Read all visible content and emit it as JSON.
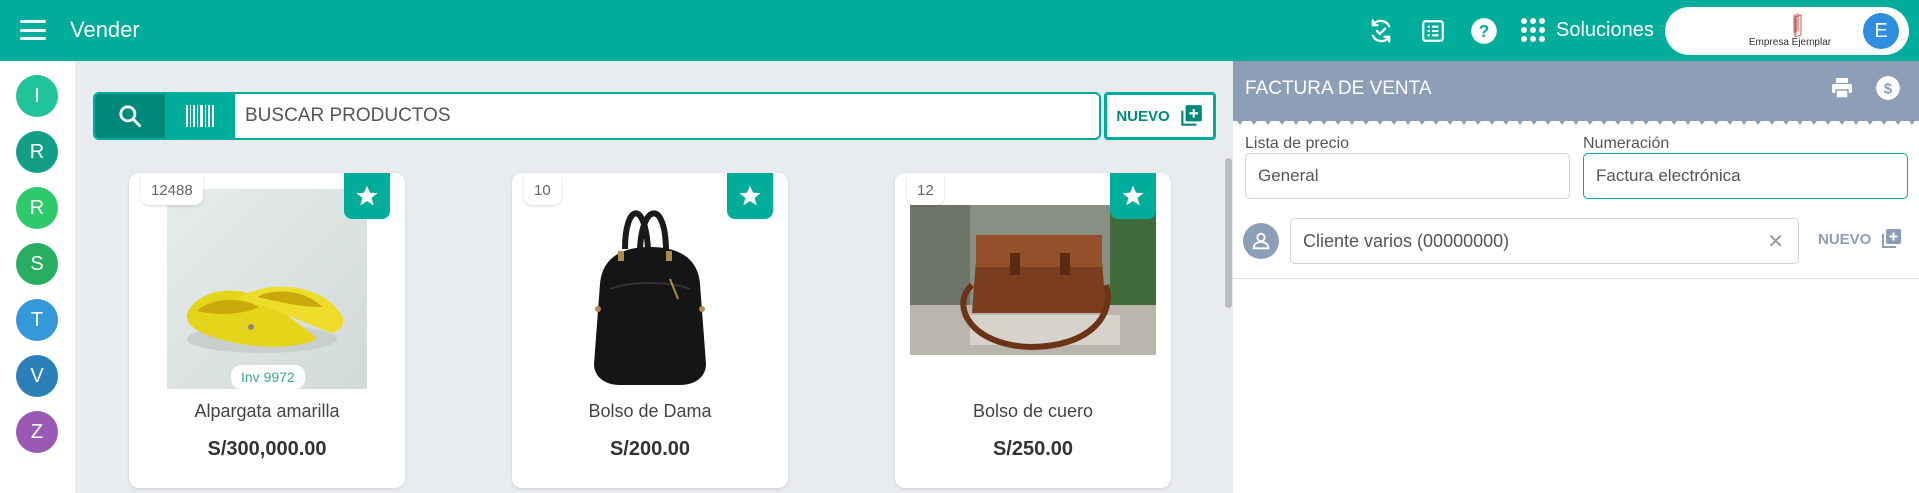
{
  "topbar": {
    "title": "Vender",
    "solutions_label": "Soluciones",
    "company_name": "Empresa Ejemplar",
    "user_initial": "E",
    "icons": [
      "menu-icon",
      "sync-icon",
      "list-icon",
      "help-icon",
      "apps-grid-icon"
    ],
    "accent_color": "#00ad9b"
  },
  "left_rail": {
    "avatars": [
      {
        "initial": "I",
        "color": "#1fc49a"
      },
      {
        "initial": "R",
        "color": "#139e86"
      },
      {
        "initial": "R",
        "color": "#2ec96b"
      },
      {
        "initial": "S",
        "color": "#27ae60"
      },
      {
        "initial": "T",
        "color": "#3498db"
      },
      {
        "initial": "V",
        "color": "#2c80b9"
      },
      {
        "initial": "Z",
        "color": "#9b59b6"
      }
    ]
  },
  "search": {
    "placeholder": "BUSCAR PRODUCTOS",
    "value": "",
    "new_label": "NUEVO"
  },
  "products": [
    {
      "id": "12488",
      "name": "Alpargata amarilla",
      "price": "S/300,000.00",
      "inventory": "Inv 9972",
      "favorite": true
    },
    {
      "id": "10",
      "name": "Bolso de Dama",
      "price": "S/200.00",
      "favorite": true
    },
    {
      "id": "12",
      "name": "Bolso de cuero",
      "price": "S/250.00",
      "favorite": true
    }
  ],
  "invoice": {
    "title": "FACTURA DE VENTA",
    "header_color": "#8d9fb7",
    "price_list_label": "Lista de precio",
    "price_list_value": "General",
    "numbering_label": "Numeración",
    "numbering_value": "Factura electrónica",
    "client_value": "Cliente varios (00000000)",
    "client_new_label": "NUEVO"
  }
}
